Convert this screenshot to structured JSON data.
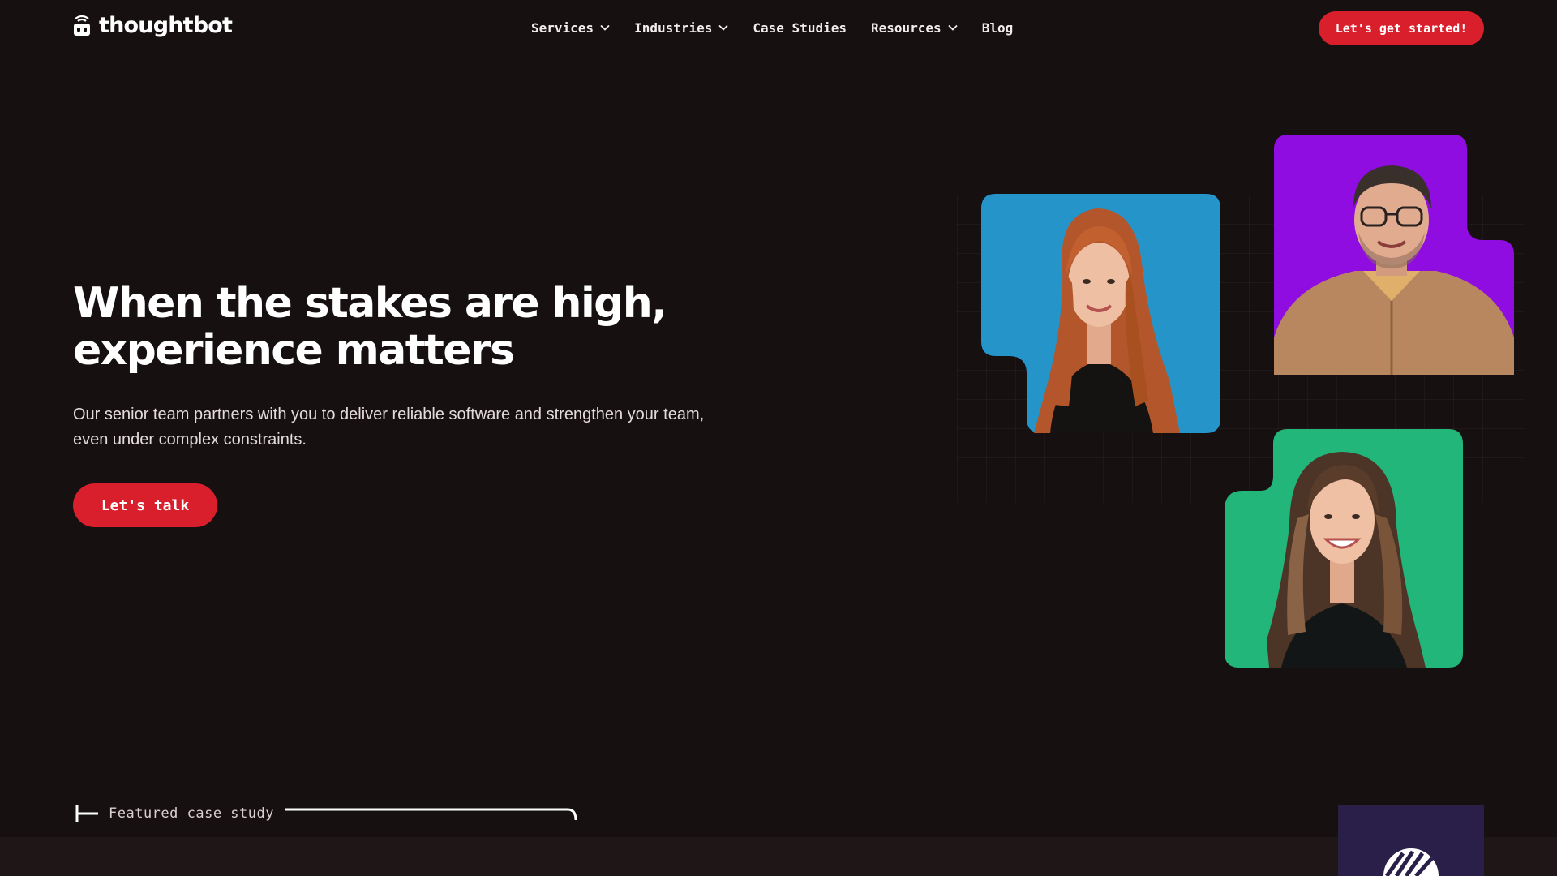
{
  "header": {
    "logo_text": "thoughtbot",
    "nav": [
      {
        "label": "Services",
        "has_dropdown": true
      },
      {
        "label": "Industries",
        "has_dropdown": true
      },
      {
        "label": "Case Studies",
        "has_dropdown": false
      },
      {
        "label": "Resources",
        "has_dropdown": true
      },
      {
        "label": "Blog",
        "has_dropdown": false
      }
    ],
    "cta_label": "Let's get started!"
  },
  "hero": {
    "title": "When the stakes are high, experience matters",
    "subtitle": "Our senior team partners with you to deliver reliable software and strengthen your team, even under complex constraints.",
    "cta_label": "Let's talk"
  },
  "portraits": [
    {
      "name": "portrait-woman-redhead",
      "bg_color": "#2494c9"
    },
    {
      "name": "portrait-man-glasses",
      "bg_color": "#8f0de0"
    },
    {
      "name": "portrait-woman-brunette",
      "bg_color": "#23b67a"
    }
  ],
  "featured": {
    "label": "Featured case study"
  },
  "colors": {
    "background": "#161011",
    "accent": "#d91f2b",
    "text": "#ffffff"
  }
}
